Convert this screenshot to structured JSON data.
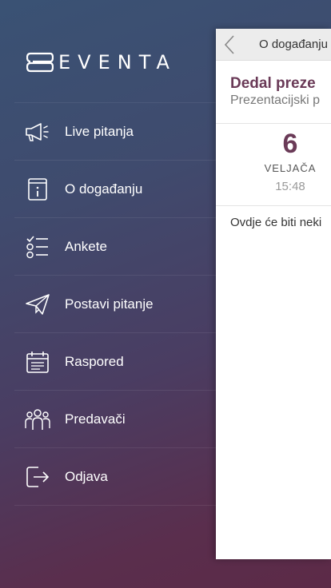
{
  "app": {
    "logo_text": "EVENTA"
  },
  "menu": [
    {
      "label": "Live pitanja",
      "icon": "megaphone-icon"
    },
    {
      "label": "O događanju",
      "icon": "info-book-icon"
    },
    {
      "label": "Ankete",
      "icon": "checklist-icon"
    },
    {
      "label": "Postavi pitanje",
      "icon": "paper-plane-icon"
    },
    {
      "label": "Raspored",
      "icon": "calendar-icon"
    },
    {
      "label": "Predavači",
      "icon": "people-icon"
    },
    {
      "label": "Odjava",
      "icon": "logout-icon"
    }
  ],
  "panel": {
    "header_title": "O događanju",
    "event_title": "Dedal preze",
    "event_subtitle": "Prezentacijski p",
    "date": {
      "day": "6",
      "month": "VELJAČA",
      "time": "15:48"
    },
    "description": "Ovdje će biti neki"
  }
}
